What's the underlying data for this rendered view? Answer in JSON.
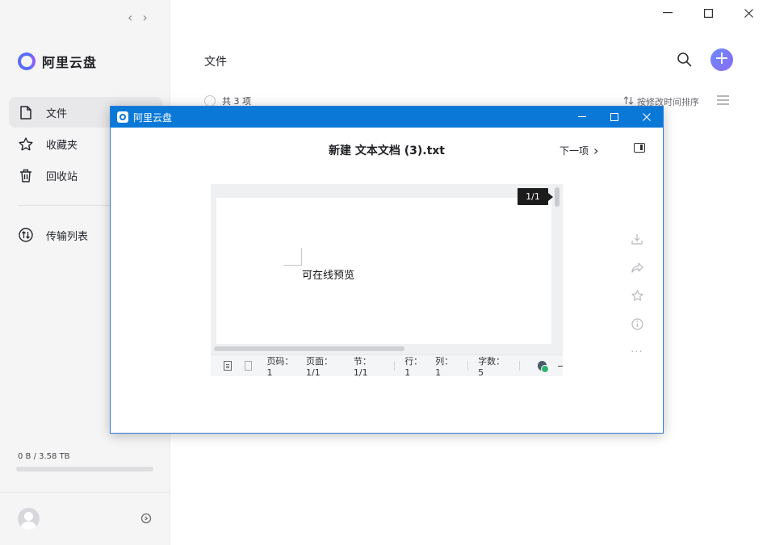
{
  "window": {
    "nav_back": "‹",
    "nav_forward": "›",
    "minimize": "—",
    "close": "✕"
  },
  "sidebar": {
    "logo_text": "阿里云盘",
    "items": [
      {
        "label": "文件",
        "icon": "file-icon",
        "active": true
      },
      {
        "label": "收藏夹",
        "icon": "star-icon",
        "active": false
      },
      {
        "label": "回收站",
        "icon": "trash-icon",
        "active": false
      }
    ],
    "transfer": {
      "label": "传输列表",
      "icon": "transfer-icon"
    },
    "storage": {
      "text": "0 B / 3.58 TB",
      "used_fraction": 0
    },
    "accent_color": "#5b6cf8"
  },
  "main": {
    "title": "文件",
    "add_label": "+",
    "item_count": "共 3 项",
    "sort_label": "按修改时间排序"
  },
  "dialog": {
    "app_title": "阿里云盘",
    "title_color": "#0a78d7",
    "controls": {
      "minimize": "—",
      "close": "✕"
    },
    "file_name": "新建 文本文档 (3).txt",
    "next_label": "下一项",
    "next_chevron": "›",
    "doc": {
      "page_badge": "1/1",
      "content": "可在线预览",
      "status": {
        "page_no": "页码：1",
        "pages": "页面：1/1",
        "section": "节：1/1",
        "row": "行：1",
        "col": "列：1",
        "words": "字数：5"
      }
    },
    "side_tools": [
      "download-icon",
      "share-icon",
      "star-icon",
      "info-icon",
      "more-icon"
    ],
    "more_label": "···"
  }
}
